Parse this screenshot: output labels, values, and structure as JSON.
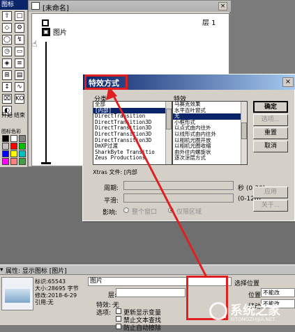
{
  "palette": {
    "title": "图标",
    "tool_glyphs": [
      "⇧",
      "□",
      "◇",
      "⚙",
      "◯",
      "↯",
      "◷",
      "▭",
      "◈",
      "≡",
      "⊞",
      "▤",
      "↕",
      "∿",
      "⌧",
      "KO",
      "◐"
    ],
    "start_label": "开始",
    "end_label": "结束",
    "color_label": "图标色彩",
    "swatches": [
      "#000000",
      "#ffffff",
      "#808080",
      "#c0c0c0",
      "#ff0000",
      "#00c000",
      "#0000ff",
      "#ffff00",
      "#00c0c0",
      "#ff00ff",
      "#ff8080",
      "#40a040"
    ]
  },
  "flowline": {
    "title": "[未命名]",
    "icon_label": "图片",
    "layer": "层 1",
    "close": "×"
  },
  "dialog": {
    "title": "特效方式",
    "close": "×",
    "category_label": "分类",
    "effects_label": "特效",
    "categories": [
      "全部",
      "[内部]",
      "DirectTransition",
      "DirectTransition3D",
      "DirectTransition3D",
      "DirectTransition3D",
      "DirectTransition3D",
      "DmXP过渡",
      "SharkByte Transitio",
      "Zeus Productions"
    ],
    "categories_selected": 1,
    "effects": [
      "马赛克效果",
      "水平百叶窗式",
      "无",
      "小框形式",
      "以点式由内往外",
      "以线形式由内往外",
      "以相机光圈开放",
      "以相机光圈收缩",
      "由外往内螺旋状",
      "逐次涂层方式"
    ],
    "effects_selected": 2,
    "buttons": {
      "ok": "确定",
      "options": "选项...",
      "reset": "重置",
      "cancel": "取消",
      "apply": "应用",
      "about": "关于..."
    },
    "xtras": "Xtras 文件: [内部",
    "period_label": "周期:",
    "period_unit": "秒 (0-30)",
    "smooth_label": "平滑:",
    "smooth_unit": "(0-128)",
    "affect_label": "影响:",
    "affect_whole": "整个窗口",
    "affect_area": "仅限区域"
  },
  "props": {
    "title": "属性: 显示图标 [图片]",
    "id": "标识:65543",
    "size": "大小:28695 字节",
    "modified": "修改:2018-6-29",
    "ref": "引用:无",
    "name": "图片",
    "layer_label": "层:",
    "effect": "特效: 无",
    "options_label": "选项:",
    "opt1": "更新显示变量",
    "opt2": "禁止文本查找",
    "opt3": "防止自动擦除",
    "choose_position": "选择位置",
    "position_label": "位置:",
    "position_value": "不能改",
    "move_label": "移动:",
    "move_value": "不能改"
  },
  "watermark": {
    "brand": "系统之家",
    "url": "XITONGZHIJIA.NET"
  }
}
